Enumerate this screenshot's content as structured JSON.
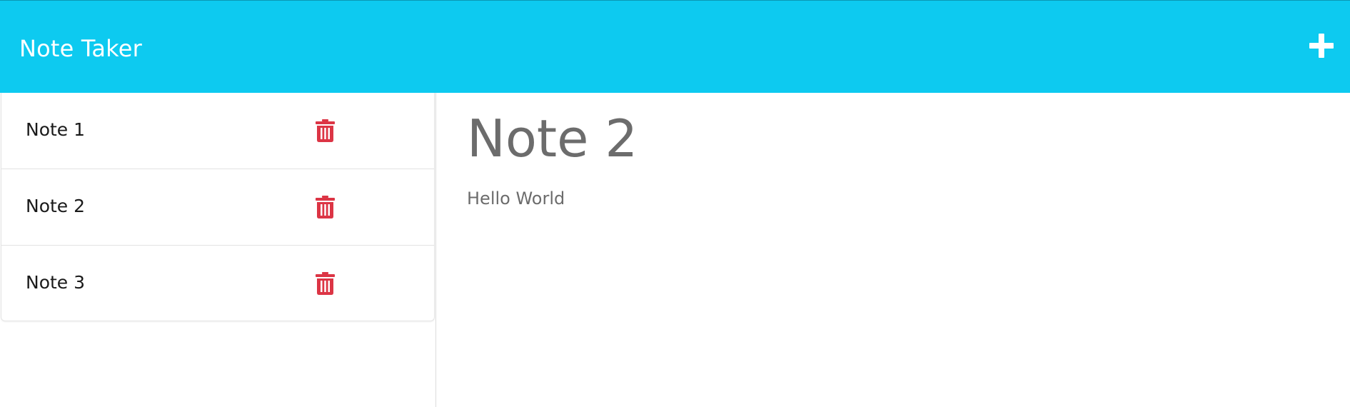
{
  "app": {
    "title": "Note Taker"
  },
  "header": {
    "add_icon": "plus-icon",
    "background_color": "#0dcaf0"
  },
  "sidebar": {
    "notes": [
      {
        "title": "Note 1",
        "delete_icon": "trash-icon"
      },
      {
        "title": "Note 2",
        "delete_icon": "trash-icon"
      },
      {
        "title": "Note 3",
        "delete_icon": "trash-icon"
      }
    ],
    "delete_color": "#dc3545"
  },
  "main": {
    "note_title": "Note 2",
    "note_text": "Hello World"
  }
}
